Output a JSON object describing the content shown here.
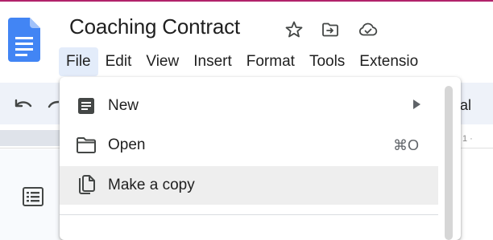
{
  "app": {
    "doc_title": "Coaching Contract",
    "brand_color": "#4285f4",
    "accent_rule_color": "#b1226b"
  },
  "title_bar": {
    "icons": [
      "star-icon",
      "move-to-folder-icon",
      "cloud-saved-icon"
    ]
  },
  "menubar": {
    "items": [
      {
        "label": "File",
        "active": true
      },
      {
        "label": "Edit"
      },
      {
        "label": "View"
      },
      {
        "label": "Insert"
      },
      {
        "label": "Format"
      },
      {
        "label": "Tools"
      },
      {
        "label": "Extensio"
      }
    ]
  },
  "toolbar": {
    "icons": [
      "undo-icon",
      "redo-icon"
    ],
    "style_fragment": "al"
  },
  "ruler": {
    "fragment": "1 ·"
  },
  "file_menu": {
    "items": [
      {
        "label": "New",
        "icon": "document-icon",
        "submenu": true
      },
      {
        "label": "Open",
        "icon": "folder-icon",
        "shortcut": "⌘O"
      },
      {
        "label": "Make a copy",
        "icon": "copy-icon",
        "hovered": true
      }
    ]
  },
  "side_panel": {
    "icons": [
      "outline-icon"
    ]
  }
}
